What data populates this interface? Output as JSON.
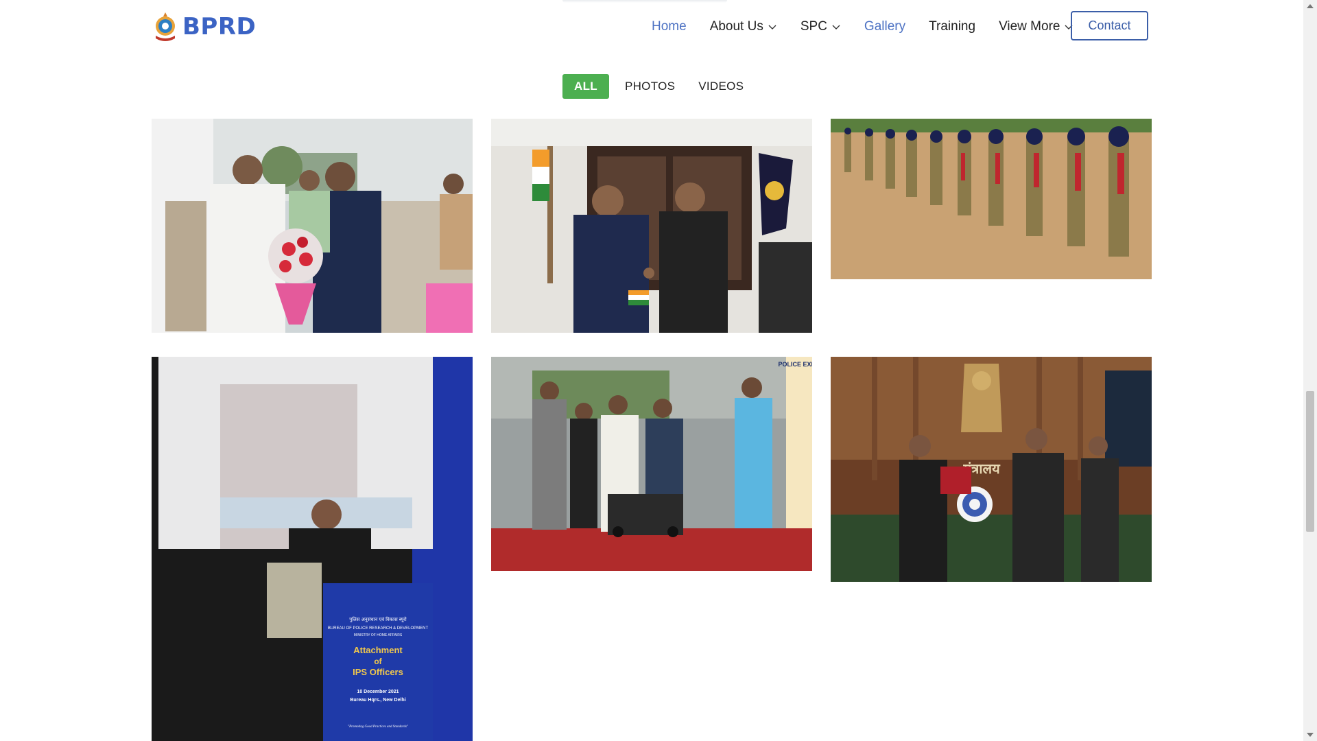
{
  "header": {
    "brand_text": "BPRD",
    "nav": {
      "home": "Home",
      "about": "About Us",
      "spc": "SPC",
      "gallery": "Gallery",
      "training": "Training",
      "view_more": "View More"
    },
    "contact_label": "Contact",
    "colors": {
      "brand": "#3b63c4",
      "nav_active": "#4d72c3",
      "contact_border": "#3b5ea8"
    }
  },
  "filters": {
    "all": "ALL",
    "photos": "PHOTOS",
    "videos": "VIDEOS",
    "active_color": "#4caf50"
  },
  "gallery": {
    "banner": {
      "line1": "पुलिस अनुसंधान एवं विकास ब्यूरो",
      "line2": "BUREAU OF POLICE RESEARCH & DEVELOPMENT",
      "line3": "MINISTRY OF HOME AFFAIRS",
      "title1": "Attachment",
      "title2": "of",
      "title3": "IPS Officers",
      "date": "10 December 2021",
      "venue": "Bureau Hqrs., New Delhi",
      "tagline": "\"Promoting Good Practices and Standards\""
    },
    "expo_sign": "POLICE EXPO",
    "ministry_sign": "मंत्रालय"
  },
  "icons": {
    "logo": "bprd-emblem-icon",
    "chevron": "chevron-down-icon"
  }
}
